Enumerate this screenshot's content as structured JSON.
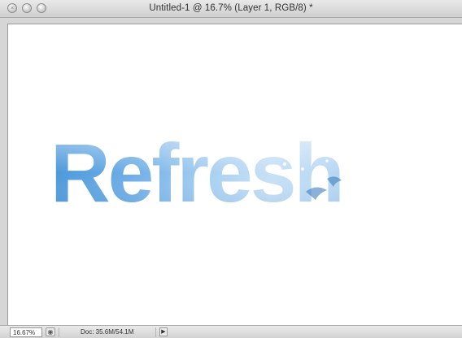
{
  "window": {
    "title": "Untitled-1 @ 16.7% (Layer 1, RGB/8) *"
  },
  "canvas": {
    "artwork_text": "Refresh",
    "colors": {
      "text_light": "#cfe4f7",
      "text_mid": "#8fc0ea",
      "text_dark": "#4f9bdc",
      "background": "#ffffff"
    }
  },
  "statusbar": {
    "zoom": "16.67%",
    "doc_info": "Doc: 35.6M/54.1M",
    "info_menu_icon": "triangle-right-icon",
    "zoom_menu_icon": "globe-icon"
  }
}
